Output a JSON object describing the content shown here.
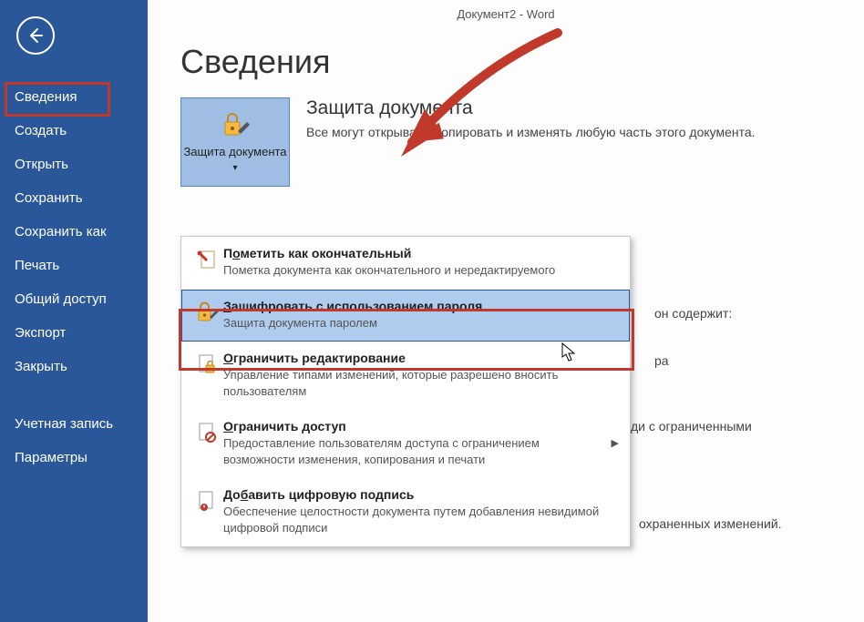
{
  "titleBar": "Документ2 - Word",
  "pageTitle": "Сведения",
  "sidebar": {
    "items": [
      "Сведения",
      "Создать",
      "Открыть",
      "Сохранить",
      "Сохранить как",
      "Печать",
      "Общий доступ",
      "Экспорт",
      "Закрыть",
      "Учетная запись",
      "Параметры"
    ]
  },
  "protect": {
    "buttonLabel": "Защита документа",
    "heading": "Защита документа",
    "desc": "Все могут открывать, копировать и изменять любую часть этого документа."
  },
  "peek": {
    "a": "он содержит:",
    "b": "ра",
    "c": "ди с ограниченными",
    "d": "охраненных изменений."
  },
  "menu": {
    "items": [
      {
        "title": "Пометить как окончательный",
        "u": 1,
        "desc": "Пометка документа как окончательного и нередактируемого",
        "icon": "final"
      },
      {
        "title": "Зашифровать с использованием пароля",
        "u": 0,
        "desc": "Защита документа паролем",
        "icon": "lock"
      },
      {
        "title": "Ограничить редактирование",
        "u": 0,
        "desc": "Управление типами изменений, которые разрешено вносить пользователям",
        "icon": "doc-lock"
      },
      {
        "title": "Ограничить доступ",
        "u": 0,
        "desc": "Предоставление пользователям доступа с ограничением возможности изменения, копирования и печати",
        "icon": "doc-restrict",
        "arrow": true
      },
      {
        "title": "Добавить цифровую подпись",
        "u": 2,
        "desc": "Обеспечение целостности документа путем добавления невидимой цифровой подписи",
        "icon": "doc-sign"
      }
    ]
  }
}
